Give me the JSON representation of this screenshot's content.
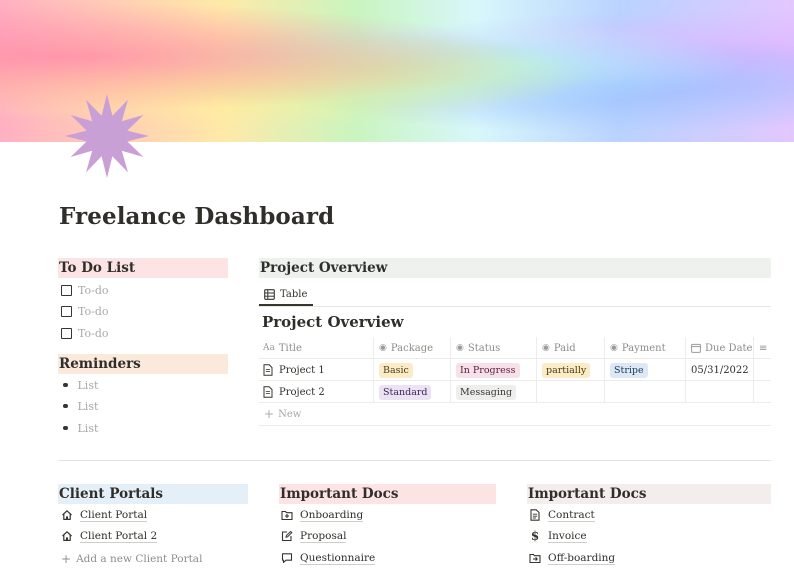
{
  "cover": {
    "gradient": "pastel-rainbow"
  },
  "page_icon": {
    "name": "starburst-icon",
    "color": "#c9a0d6"
  },
  "title": "Freelance Dashboard",
  "todo": {
    "heading": "To Do List",
    "heading_bg": "#fde4e4",
    "items": [
      {
        "label": "To-do"
      },
      {
        "label": "To-do"
      },
      {
        "label": "To-do"
      }
    ]
  },
  "reminders": {
    "heading": "Reminders",
    "heading_bg": "#fbe9dc",
    "items": [
      {
        "label": "List"
      },
      {
        "label": "List"
      },
      {
        "label": "List"
      }
    ]
  },
  "project_overview": {
    "heading": "Project Overview",
    "heading_bg": "#edf2ec",
    "view_tab": {
      "icon": "table-icon",
      "label": "Table"
    },
    "database_title": "Project Overview",
    "columns": [
      {
        "label": "Title",
        "icon": "text-icon"
      },
      {
        "label": "Package",
        "icon": "select-icon"
      },
      {
        "label": "Status",
        "icon": "select-icon"
      },
      {
        "label": "Paid",
        "icon": "select-icon"
      },
      {
        "label": "Payment",
        "icon": "select-icon"
      },
      {
        "label": "Due Date",
        "icon": "calendar-icon"
      }
    ],
    "rows": [
      {
        "title": "Project 1",
        "package": "Basic",
        "status": "In Progress",
        "paid": "partially",
        "payment": "Stripe",
        "due_date": "05/31/2022"
      },
      {
        "title": "Project 2",
        "package": "Standard",
        "status": "Messaging",
        "paid": "",
        "payment": "",
        "due_date": ""
      }
    ],
    "tag_colors": {
      "Basic": "#fbecc7",
      "Standard": "#ebe2f3",
      "In Progress": "#f6e1ea",
      "Messaging": "#eeeeec",
      "partially": "#fbecc7",
      "Stripe": "#dce9f5"
    },
    "new_label": "New"
  },
  "client_portals": {
    "heading": "Client Portals",
    "heading_bg": "#e5eff8",
    "items": [
      {
        "label": "Client Portal",
        "icon": "house-icon"
      },
      {
        "label": "Client Portal 2",
        "icon": "house-icon"
      }
    ],
    "add_label": "Add a new Client Portal"
  },
  "important_docs_1": {
    "heading": "Important Docs",
    "heading_bg": "#fde4e4",
    "items": [
      {
        "label": "Onboarding",
        "icon": "folder-plus-icon"
      },
      {
        "label": "Proposal",
        "icon": "edit-icon"
      },
      {
        "label": "Questionnaire",
        "icon": "chat-icon"
      }
    ]
  },
  "important_docs_2": {
    "heading": "Important Docs",
    "heading_bg": "#f3edec",
    "items": [
      {
        "label": "Contract",
        "icon": "document-icon"
      },
      {
        "label": "Invoice",
        "icon": "dollar-icon"
      },
      {
        "label": "Off-boarding",
        "icon": "folder-export-icon"
      }
    ]
  }
}
